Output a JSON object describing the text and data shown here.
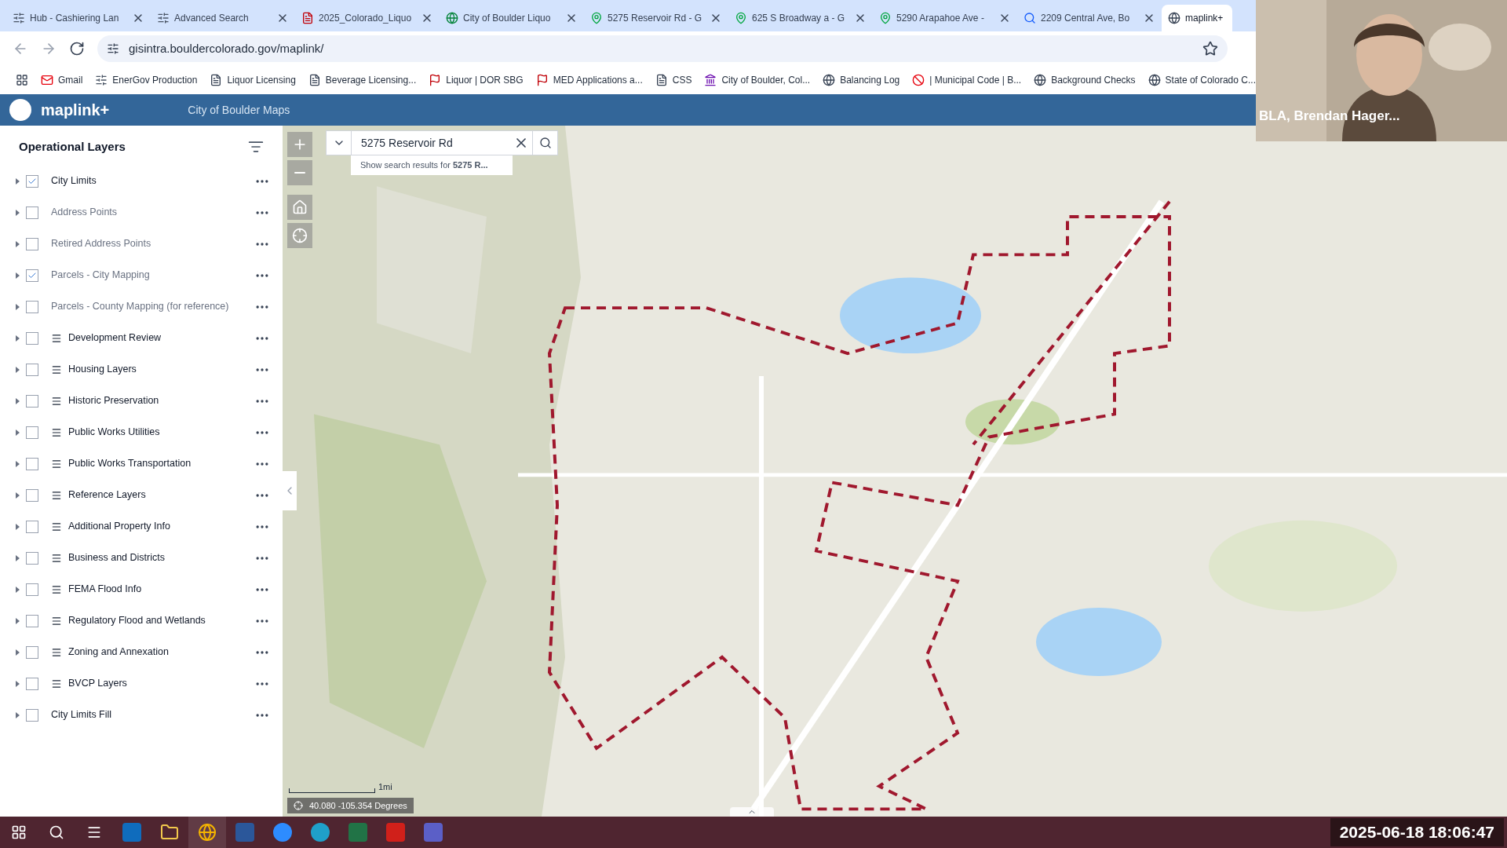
{
  "browser": {
    "tabs": [
      {
        "kind": "portal",
        "title": "Hub - Cashiering Lan",
        "selected": false
      },
      {
        "kind": "portal",
        "title": "Advanced Search",
        "selected": false
      },
      {
        "kind": "pdf",
        "title": "2025_Colorado_Liquo",
        "selected": false
      },
      {
        "kind": "site",
        "title": "City of Boulder Liquo",
        "selected": false
      },
      {
        "kind": "maps",
        "title": "5275 Reservoir Rd - G",
        "selected": false
      },
      {
        "kind": "maps",
        "title": "625 S Broadway a - G",
        "selected": false
      },
      {
        "kind": "maps",
        "title": "5290 Arapahoe Ave -",
        "selected": false
      },
      {
        "kind": "google",
        "title": "2209 Central Ave, Bo",
        "selected": false
      },
      {
        "kind": "web",
        "title": "maplink+",
        "selected": true
      }
    ],
    "url": "gisintra.bouldercolorado.gov/maplink/",
    "bookmarks": [
      {
        "kind": "mail",
        "label": "Gmail"
      },
      {
        "kind": "portal",
        "label": "EnerGov Production"
      },
      {
        "kind": "doc",
        "label": "Liquor Licensing"
      },
      {
        "kind": "doc",
        "label": "Beverage Licensing..."
      },
      {
        "kind": "state",
        "label": "Liquor | DOR SBG"
      },
      {
        "kind": "state",
        "label": "MED Applications a..."
      },
      {
        "kind": "doc",
        "label": "CSS"
      },
      {
        "kind": "site",
        "label": "City of Boulder, Col..."
      },
      {
        "kind": "web",
        "label": "Balancing Log"
      },
      {
        "kind": "block",
        "label": "| Municipal Code | B..."
      },
      {
        "kind": "web",
        "label": "Background Checks"
      },
      {
        "kind": "web",
        "label": "State of Colorado C..."
      }
    ]
  },
  "app": {
    "name": "maplink+",
    "subtitle": "City of Boulder Maps"
  },
  "layers_panel": {
    "title": "Operational Layers",
    "layers": [
      {
        "kind": "layer",
        "label": "City Limits",
        "checked": true,
        "disabled": false
      },
      {
        "kind": "layer",
        "label": "Address Points",
        "checked": false,
        "disabled": true
      },
      {
        "kind": "layer",
        "label": "Retired Address Points",
        "checked": false,
        "disabled": true
      },
      {
        "kind": "layer",
        "label": "Parcels - City Mapping",
        "checked": true,
        "disabled": true
      },
      {
        "kind": "layer",
        "label": "Parcels - County Mapping (for reference)",
        "checked": false,
        "disabled": true
      },
      {
        "kind": "group",
        "label": "Development Review",
        "checked": false,
        "disabled": false
      },
      {
        "kind": "group",
        "label": "Housing Layers",
        "checked": false,
        "disabled": false
      },
      {
        "kind": "group",
        "label": "Historic Preservation",
        "checked": false,
        "disabled": false
      },
      {
        "kind": "group",
        "label": "Public Works Utilities",
        "checked": false,
        "disabled": false
      },
      {
        "kind": "group",
        "label": "Public Works Transportation",
        "checked": false,
        "disabled": false
      },
      {
        "kind": "group",
        "label": "Reference Layers",
        "checked": false,
        "disabled": false
      },
      {
        "kind": "group",
        "label": "Additional Property Info",
        "checked": false,
        "disabled": false
      },
      {
        "kind": "group",
        "label": "Business and Districts",
        "checked": false,
        "disabled": false
      },
      {
        "kind": "group",
        "label": "FEMA Flood Info",
        "checked": false,
        "disabled": false
      },
      {
        "kind": "group",
        "label": "Regulatory Flood and Wetlands",
        "checked": false,
        "disabled": false
      },
      {
        "kind": "group",
        "label": "Zoning and Annexation",
        "checked": false,
        "disabled": false
      },
      {
        "kind": "group",
        "label": "BVCP Layers",
        "checked": false,
        "disabled": false
      },
      {
        "kind": "layer",
        "label": "City Limits Fill",
        "checked": false,
        "disabled": false
      }
    ]
  },
  "map": {
    "search": {
      "value": "5275 Reservoir Rd",
      "suggestion": "Show search results for **5275 R...**"
    },
    "scale": "1mi",
    "coordinates": "40.080 -105.354 Degrees"
  },
  "webcam": {
    "name": "BLA, Brendan Hager..."
  },
  "timestamp": "2025-06-18 18:06:47"
}
